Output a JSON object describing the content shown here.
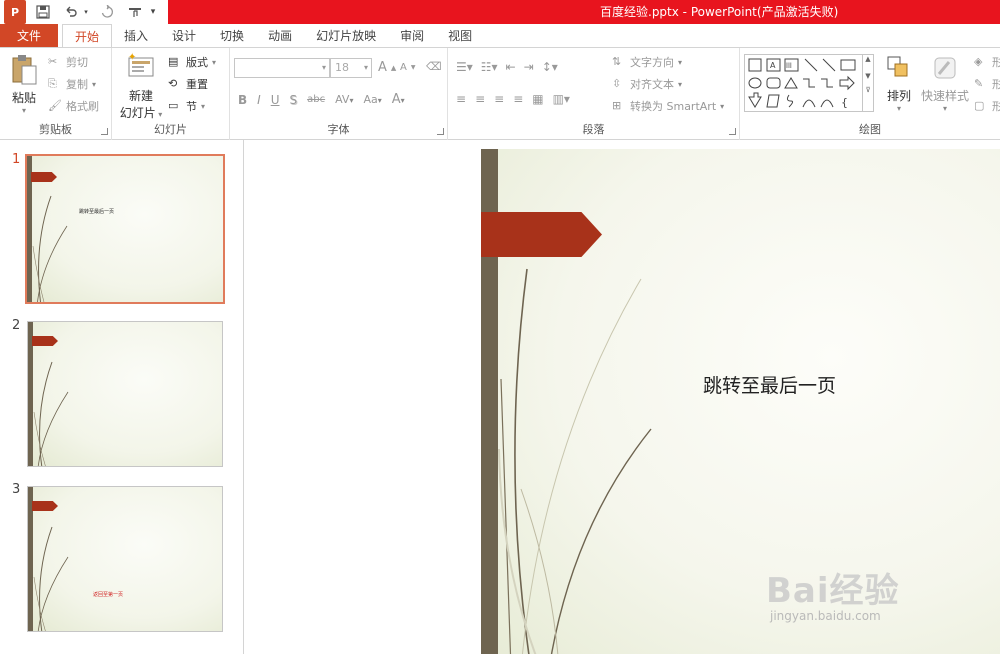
{
  "window": {
    "title": "百度经验.pptx -   PowerPoint(产品激活失败)",
    "app_logo": "P",
    "qat": [
      "save-icon",
      "undo-icon",
      "redo-icon",
      "touch-mode-icon",
      "customize-qat-icon"
    ]
  },
  "tabs": [
    {
      "id": "file",
      "label": "文件"
    },
    {
      "id": "home",
      "label": "开始"
    },
    {
      "id": "insert",
      "label": "插入"
    },
    {
      "id": "design",
      "label": "设计"
    },
    {
      "id": "transitions",
      "label": "切换"
    },
    {
      "id": "animations",
      "label": "动画"
    },
    {
      "id": "slideshow",
      "label": "幻灯片放映"
    },
    {
      "id": "review",
      "label": "审阅"
    },
    {
      "id": "view",
      "label": "视图"
    }
  ],
  "ribbon": {
    "clipboard": {
      "label": "剪贴板",
      "paste": "粘贴",
      "cut": "剪切",
      "copy": "复制",
      "format_painter": "格式刷"
    },
    "slides": {
      "label": "幻灯片",
      "new_slide_line1": "新建",
      "new_slide_line2": "幻灯片",
      "layout": "版式",
      "reset": "重置",
      "section": "节"
    },
    "font": {
      "label": "字体",
      "font_name": "",
      "font_size": "18",
      "bold": "B",
      "italic": "I",
      "underline": "U",
      "shadow": "S",
      "strike": "abc",
      "spacing": "AV",
      "case": "Aa",
      "color": "A",
      "grow": "A",
      "shrink": "A"
    },
    "paragraph": {
      "label": "段落",
      "text_direction": "文字方向",
      "align_text": "对齐文本",
      "convert_smartart": "转换为 SmartArt"
    },
    "drawing": {
      "label": "绘图",
      "arrange": "排列",
      "quick_styles": "快速样式",
      "shape_fill": "形",
      "shape_outline": "形",
      "shape_effects": "形"
    }
  },
  "slides": [
    {
      "number": "1",
      "text": "跳转至最后一页",
      "text_color": "#222222"
    },
    {
      "number": "2",
      "text": ""
    },
    {
      "number": "3",
      "text": "返回至第一页",
      "text_color": "#d02020"
    }
  ],
  "current_slide": {
    "text": "跳转至最后一页"
  },
  "watermark": {
    "brand": "Bai经验",
    "url": "jingyan.baidu.com"
  },
  "colors": {
    "accent": "#d24726",
    "title_bar": "#e8141e",
    "slide_bar": "#6e6450",
    "flag": "#a8321a"
  }
}
